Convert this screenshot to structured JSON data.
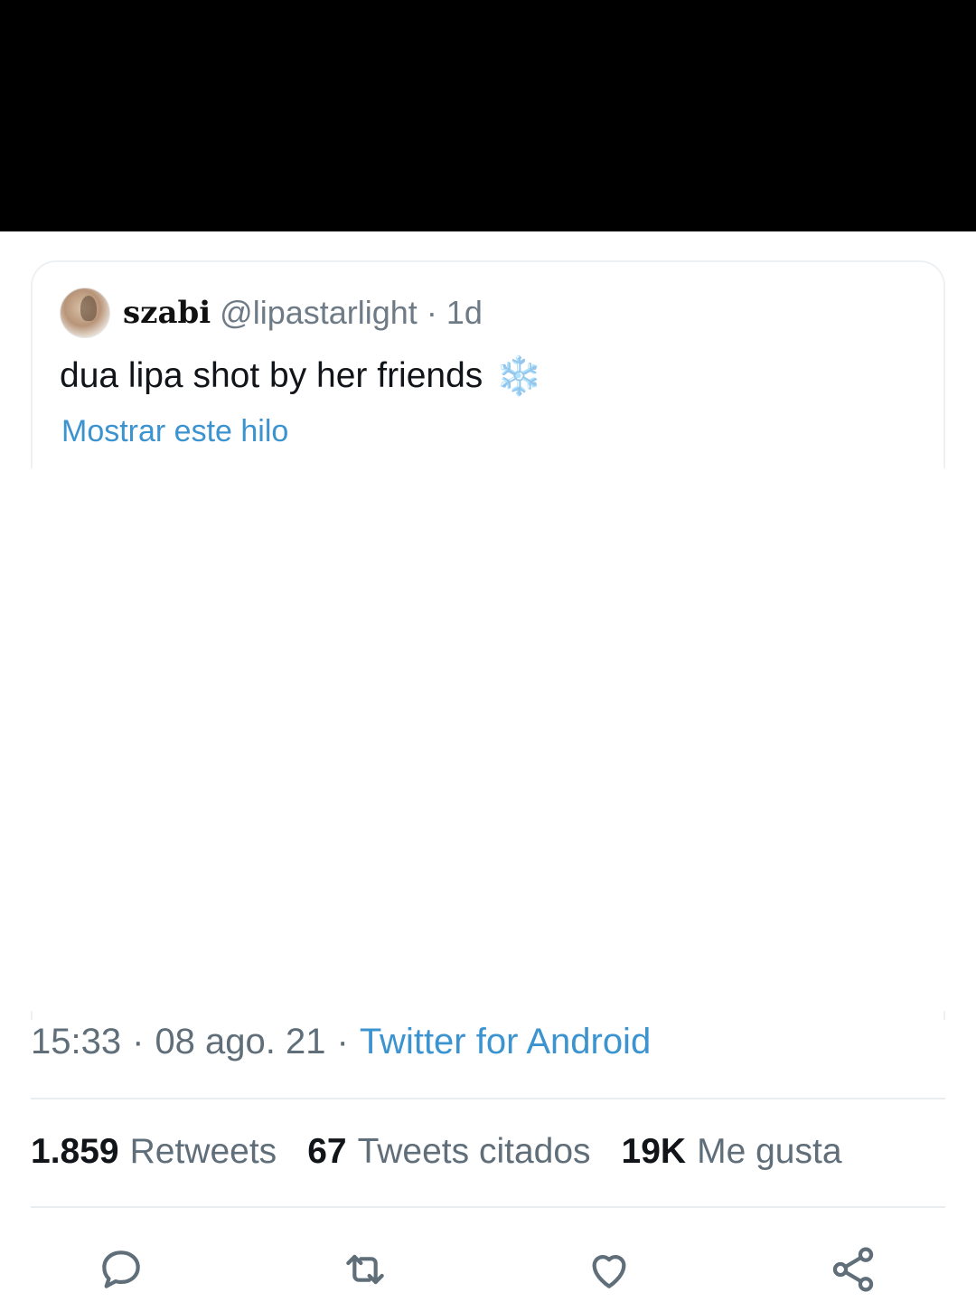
{
  "quoted_tweet": {
    "author_name": "szabi",
    "author_handle": "@lipastarlight",
    "separator": "·",
    "age": "1d",
    "text": "dua lipa shot by her friends",
    "emoji": "❄️",
    "show_thread_label": "Mostrar este hilo"
  },
  "tweet_meta": {
    "time": "15:33",
    "separator": "·",
    "date": "08 ago. 21",
    "source": "Twitter for Android"
  },
  "stats": {
    "retweets_count": "1.859",
    "retweets_label": "Retweets",
    "quotes_count": "67",
    "quotes_label": "Tweets citados",
    "likes_count": "19K",
    "likes_label": "Me gusta"
  },
  "actions": {
    "icons": [
      "reply-icon",
      "retweet-icon",
      "like-icon",
      "share-icon"
    ]
  },
  "colors": {
    "link": "#3b93cf",
    "secondary_text": "#5f6e79",
    "icon": "#5f6e79"
  }
}
